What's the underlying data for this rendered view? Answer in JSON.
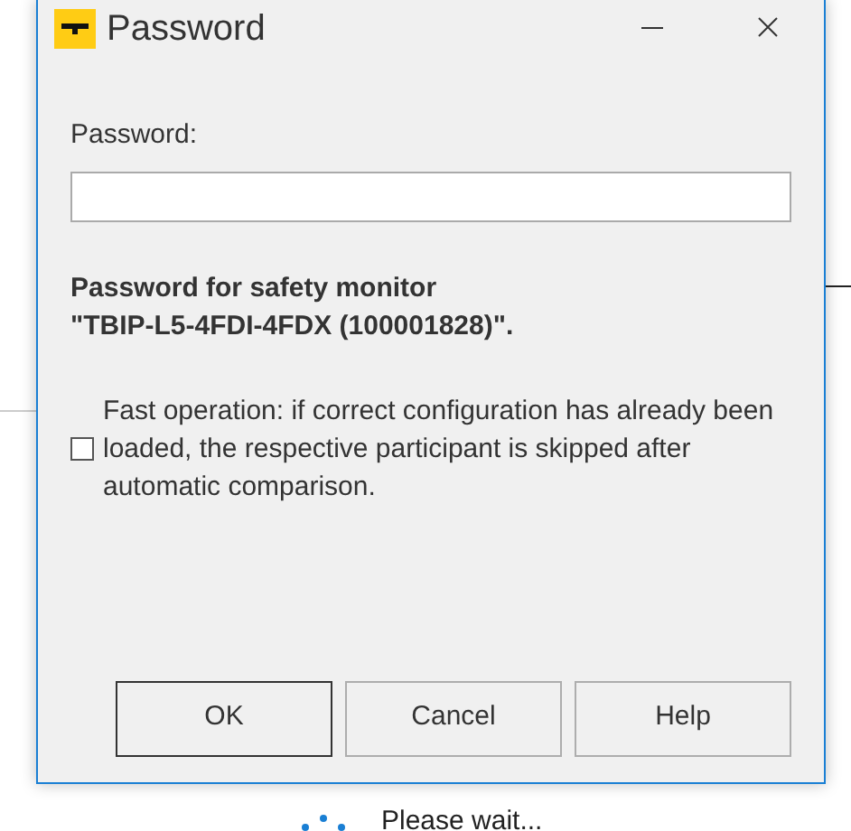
{
  "background": {
    "status": "Please wait..."
  },
  "dialog": {
    "title": "Password",
    "label": "Password:",
    "message": "Password for safety monitor\n\"TBIP-L5-4FDI-4FDX (100001828)\".",
    "option": {
      "label": "Fast operation: if correct configuration has already been loaded, the respective participant is skipped after automatic comparison.",
      "checked": false
    },
    "buttons": [
      {
        "label": "OK",
        "default": true
      },
      {
        "label": "Cancel",
        "default": false
      },
      {
        "label": "Help",
        "default": false
      }
    ]
  }
}
